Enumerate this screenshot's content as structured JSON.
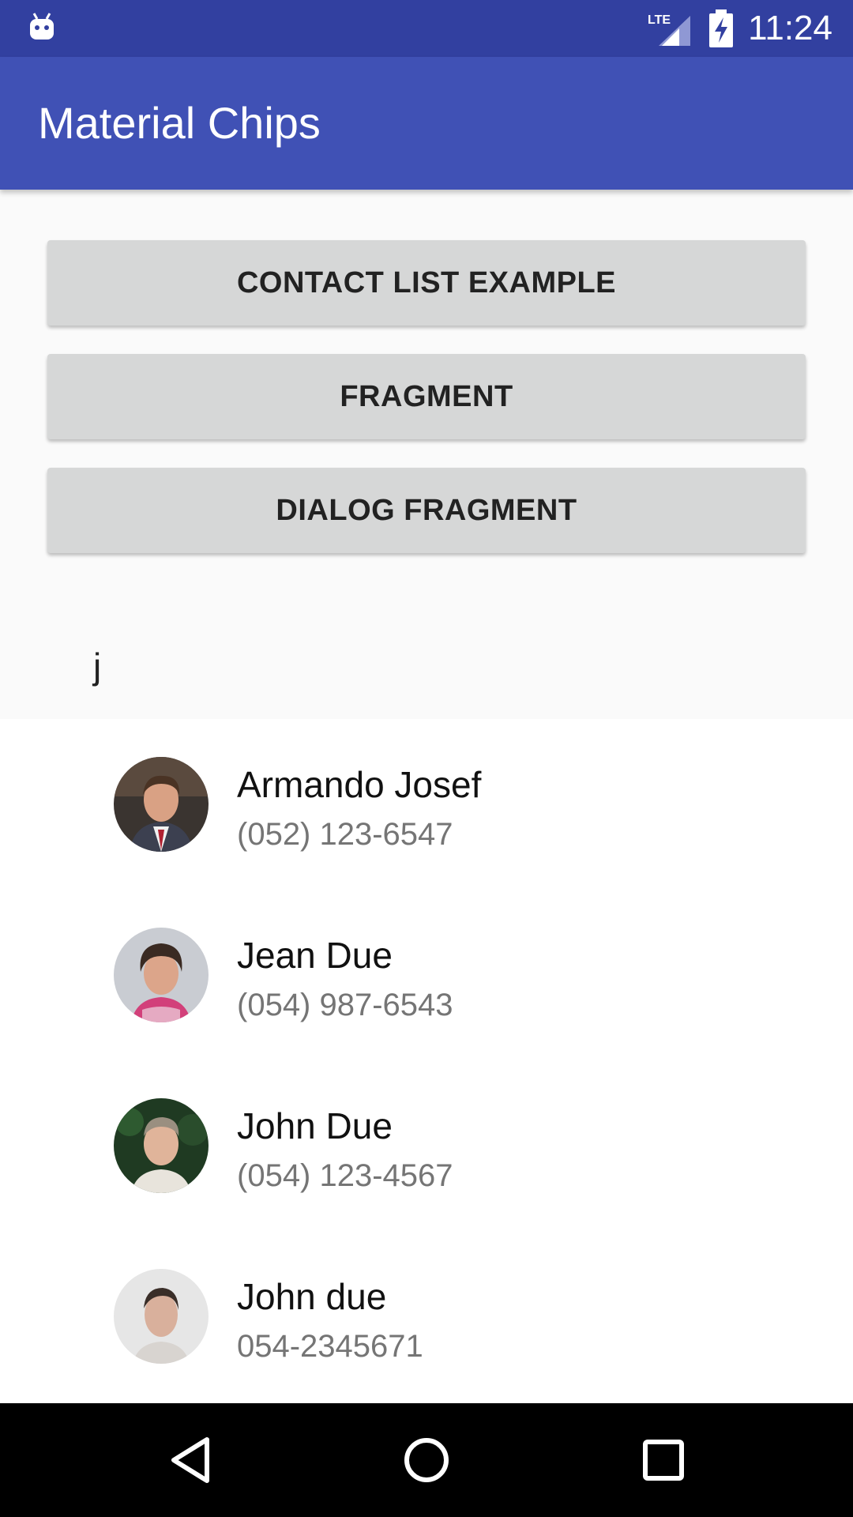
{
  "status_bar": {
    "time": "11:24",
    "network": "LTE",
    "icons": [
      "android-icon",
      "lte-signal-icon",
      "battery-charging-icon"
    ]
  },
  "app_bar": {
    "title": "Material Chips"
  },
  "buttons": {
    "contact_list": "CONTACT LIST EXAMPLE",
    "fragment": "FRAGMENT",
    "dialog_fragment": "DIALOG FRAGMENT"
  },
  "chips_input": {
    "value": "j"
  },
  "contacts": [
    {
      "name": "Armando Josef",
      "phone": "(052) 123-6547"
    },
    {
      "name": "Jean Due",
      "phone": "(054) 987-6543"
    },
    {
      "name": "John Due",
      "phone": "(054) 123-4567"
    },
    {
      "name": "John due",
      "phone": "054-2345671"
    }
  ],
  "nav_bar": {
    "icons": [
      "back-icon",
      "home-icon",
      "recents-icon"
    ]
  },
  "colors": {
    "status_bar": "#3240a0",
    "app_bar": "#4051b5",
    "button": "#d6d7d7",
    "phone_text": "#757575"
  }
}
